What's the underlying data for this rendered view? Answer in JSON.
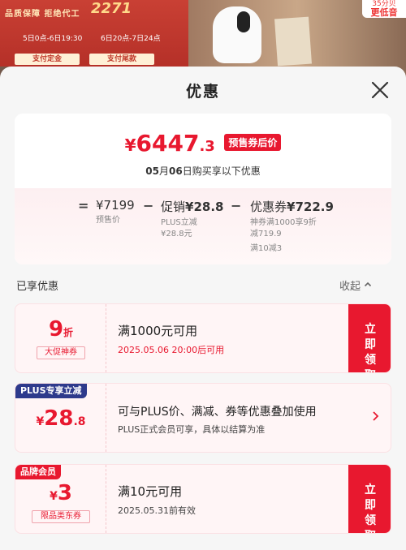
{
  "background": {
    "banner_tag": "品质保障 拒绝代工",
    "banner_number": "2271",
    "time_left": "5日0点-6日19:30",
    "time_right": "6日20点-7日24点",
    "btn_left": "支付定金",
    "btn_right": "支付尾款",
    "badge_top": "35分贝",
    "badge_bottom": "更低音"
  },
  "sheet": {
    "title": "优惠",
    "summary": {
      "price_yen": "¥",
      "price_int": "6447",
      "price_dec": ".3",
      "badge": "预售券后价",
      "date_month": "05",
      "date_month_unit": "月",
      "date_day": "06",
      "date_suffix": "日购买享以下优惠",
      "calc": {
        "eq": "=",
        "base_value": "¥7199",
        "base_label": "预售价",
        "minus1": "−",
        "promo_title": "促销",
        "promo_value": "¥28.8",
        "promo_line1": "PLUS立减",
        "promo_line2": "¥28.8元",
        "minus2": "−",
        "coupon_title": "优惠券",
        "coupon_value": "¥722.9",
        "coupon_line1": "神券满1000享9折",
        "coupon_line2": "减719.9",
        "coupon_line3": "满10减3"
      }
    },
    "section_title": "已享优惠",
    "collapse_label": "收起",
    "coupons": [
      {
        "amount": "9",
        "unit": "折",
        "label": "大促神券",
        "title": "满1000元可用",
        "sub": "2025.05.06 20:00后可用",
        "action": "立即领取"
      },
      {
        "corner": "PLUS专享立减",
        "amount_prefix": "¥",
        "amount": "28",
        "amount_dec": ".8",
        "title": "可与PLUS价、满减、券等优惠叠加使用",
        "sub": "PLUS正式会员可享，具体以结算为准"
      },
      {
        "corner": "品牌会员",
        "amount_prefix": "¥",
        "amount": "3",
        "label": "限品类东券",
        "title": "满10元可用",
        "sub": "2025.05.31前有效",
        "action": "立即领取"
      }
    ]
  },
  "colors": {
    "accent": "#e8182f",
    "plus_badge": "#2d3a8c",
    "brand_badge": "#e8182f"
  },
  "icons": {
    "close": "close-icon",
    "collapse": "chevron-up-icon",
    "detail": "chevron-right-icon"
  }
}
